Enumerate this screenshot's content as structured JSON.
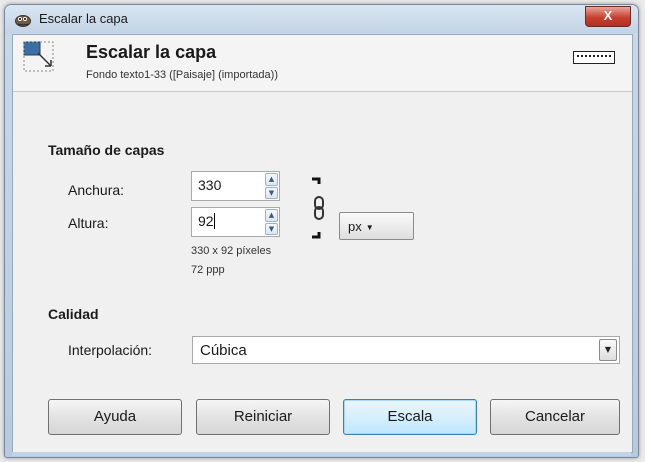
{
  "window": {
    "title": "Escalar la capa",
    "close_label": "X"
  },
  "header": {
    "title": "Escalar la capa",
    "subtitle": "Fondo texto1-33 ([Paisaje] (importada))"
  },
  "size_section": {
    "label": "Tamaño de capas",
    "width_label": "Anchura:",
    "width_value": "330",
    "height_label": "Altura:",
    "height_value": "92",
    "unit": "px",
    "dimensions_text": "330 x 92 píxeles",
    "resolution_text": "72 ppp"
  },
  "quality_section": {
    "label": "Calidad",
    "interpolation_label": "Interpolación:",
    "interpolation_value": "Cúbica"
  },
  "buttons": {
    "help": "Ayuda",
    "reset": "Reiniciar",
    "scale": "Escala",
    "cancel": "Cancelar"
  },
  "icons": {
    "app": "gimp-icon",
    "scale": "scale-layer-icon",
    "preview": "layer-preview-icon",
    "chain": "chain-link-icon"
  }
}
